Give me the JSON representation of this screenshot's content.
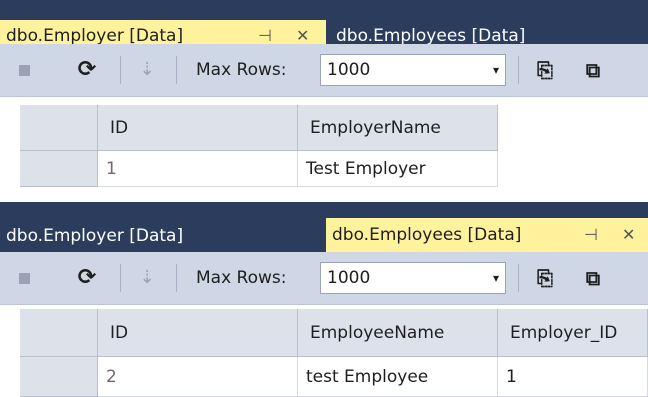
{
  "panel1": {
    "active_tab": "dbo.Employer [Data]",
    "inactive_tab": "dbo.Employees [Data]",
    "toolbar": {
      "max_rows_label": "Max Rows:",
      "max_rows_value": "1000"
    },
    "columns": [
      "ID",
      "EmployerName"
    ],
    "rows": [
      {
        "id": "1",
        "name": "Test Employer"
      }
    ]
  },
  "panel2": {
    "inactive_tab": "dbo.Employer [Data]",
    "active_tab": "dbo.Employees [Data]",
    "toolbar": {
      "max_rows_label": "Max Rows:",
      "max_rows_value": "1000"
    },
    "columns": [
      "ID",
      "EmployeeName",
      "Employer_ID"
    ],
    "rows": [
      {
        "id": "2",
        "name": "test Employee",
        "employer_id": "1"
      }
    ]
  },
  "glyphs": {
    "pin": "⊣",
    "close": "✕",
    "dropdown": "▾",
    "refresh": "⟳"
  },
  "colors": {
    "active_tab": "#fff29d",
    "frame": "#2b3c5c",
    "toolbar": "#cfd6e5",
    "header": "#dde2ea"
  }
}
